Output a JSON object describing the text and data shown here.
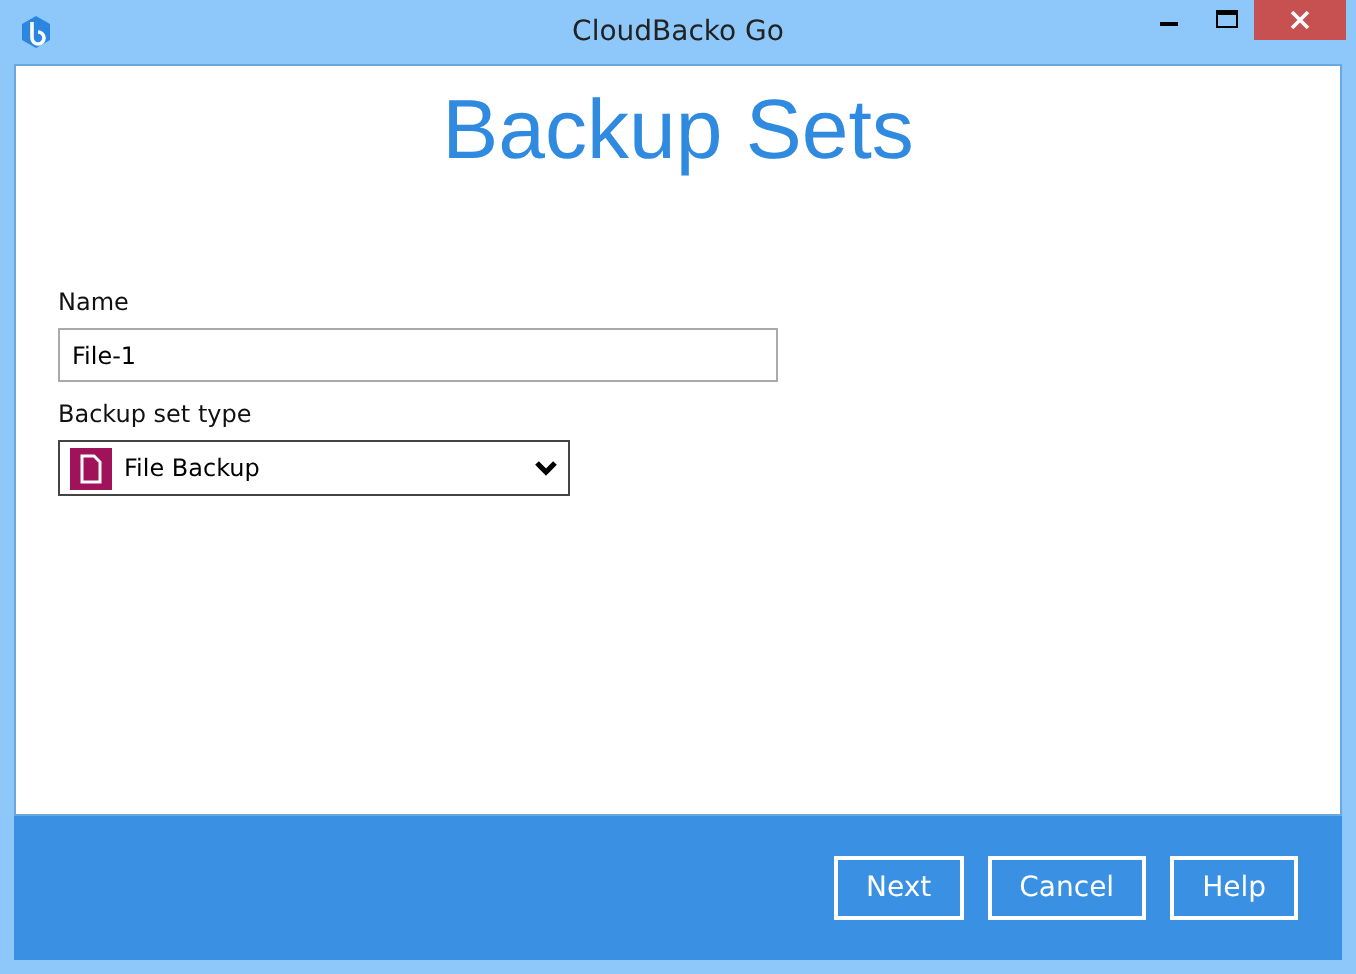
{
  "window": {
    "title": "CloudBacko Go"
  },
  "heading": "Backup Sets",
  "name_field": {
    "label": "Name",
    "value": "File-1"
  },
  "type_field": {
    "label": "Backup set type",
    "value": "File Backup"
  },
  "buttons": [
    "Next",
    "Cancel",
    "Help"
  ]
}
